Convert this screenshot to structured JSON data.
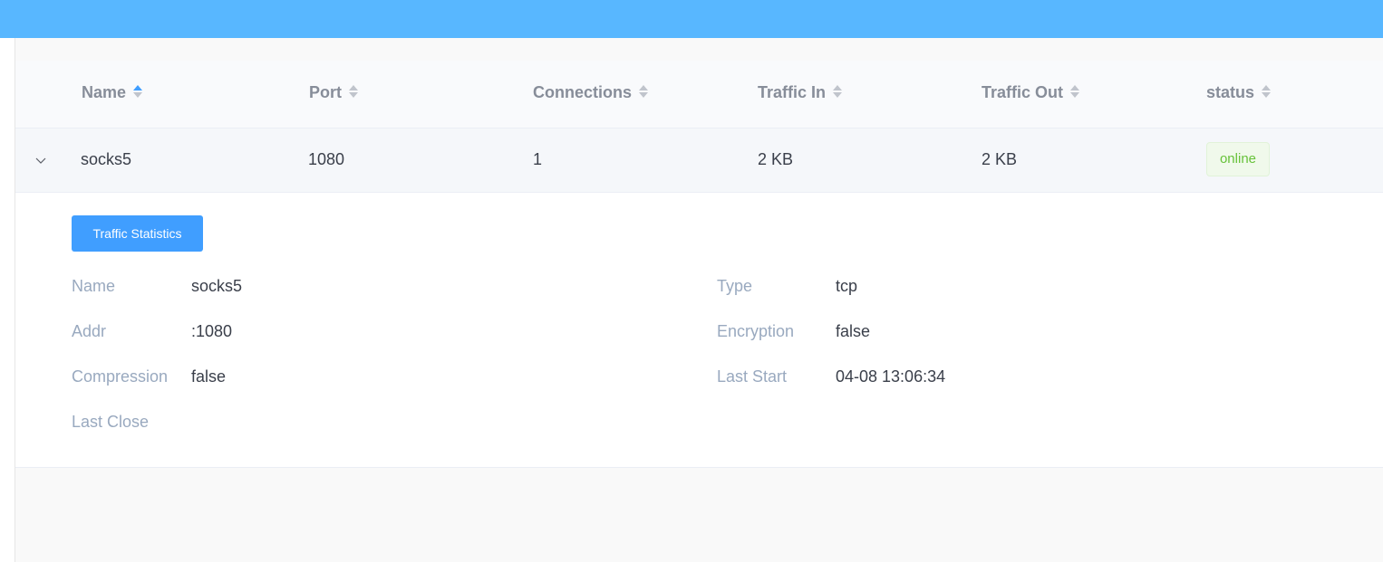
{
  "colors": {
    "topbar": "#58b7ff",
    "primary": "#409eff",
    "online_text": "#67c23a",
    "online_bg": "#f0f9eb",
    "header_text": "#878d99",
    "label_text": "#99a9bf"
  },
  "table": {
    "columns": [
      {
        "label": "Name",
        "sort": "ascending"
      },
      {
        "label": "Port",
        "sort": "none"
      },
      {
        "label": "Connections",
        "sort": "none"
      },
      {
        "label": "Traffic In",
        "sort": "none"
      },
      {
        "label": "Traffic Out",
        "sort": "none"
      },
      {
        "label": "status",
        "sort": "none"
      }
    ],
    "rows": [
      {
        "name": "socks5",
        "port": "1080",
        "connections": "1",
        "traffic_in": "2 KB",
        "traffic_out": "2 KB",
        "status": "online",
        "expanded": true,
        "expand_icon": "chevron-down-icon"
      }
    ]
  },
  "details": {
    "stats_button_label": "Traffic Statistics",
    "left": [
      {
        "label": "Name",
        "value": "socks5"
      },
      {
        "label": "Addr",
        "value": ":1080"
      },
      {
        "label": "Compression",
        "value": "false"
      },
      {
        "label": "Last Close",
        "value": ""
      }
    ],
    "right": [
      {
        "label": "Type",
        "value": "tcp"
      },
      {
        "label": "Encryption",
        "value": "false"
      },
      {
        "label": "Last Start",
        "value": "04-08 13:06:34"
      }
    ]
  }
}
